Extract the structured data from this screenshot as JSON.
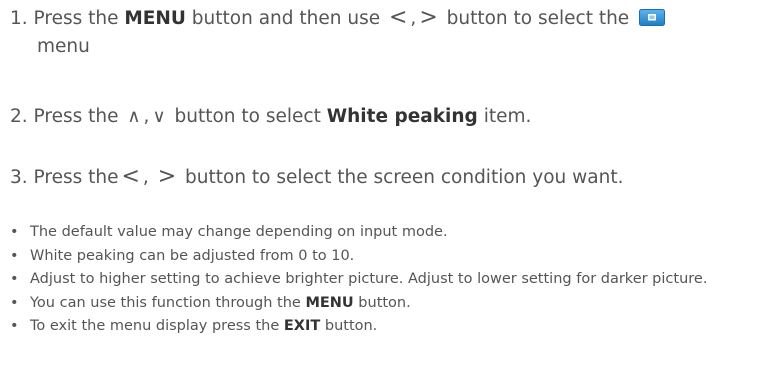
{
  "steps": [
    {
      "number": "1.",
      "text_a": "Press the ",
      "bold_a": "MENU",
      "text_b": " button and then use ",
      "sym_left": "<",
      "sym_sep": ",",
      "sym_right": ">",
      "text_c": " button to select the",
      "icon": "picture-menu-icon",
      "line2": "menu"
    },
    {
      "number": "2.",
      "text_a": "Press the ",
      "sym_up": "∧",
      "sym_sep": ",",
      "sym_down": "∨",
      "text_b": " button to select ",
      "bold_a": "White peaking",
      "text_c": " item."
    },
    {
      "number": "3.",
      "text_a": "Press the",
      "sym_left": "<",
      "sym_sep": ",",
      "sym_right": ">",
      "text_b": "button to select the screen condition you want."
    }
  ],
  "bullets": [
    {
      "text": "The default value may change depending on input mode."
    },
    {
      "text": "White peaking can be adjusted from 0 to 10."
    },
    {
      "text": "Adjust to higher setting to achieve brighter picture. Adjust to lower setting for darker picture."
    },
    {
      "text_a": "You can use this function through the ",
      "bold": "MENU",
      "text_b": " button."
    },
    {
      "text_a": "To exit the menu display press the ",
      "bold": "EXIT",
      "text_b": " button."
    }
  ],
  "bullet_char": "•",
  "colors": {
    "text": "#555555",
    "bold": "#333333",
    "icon_blue": "#2c8fd6"
  }
}
